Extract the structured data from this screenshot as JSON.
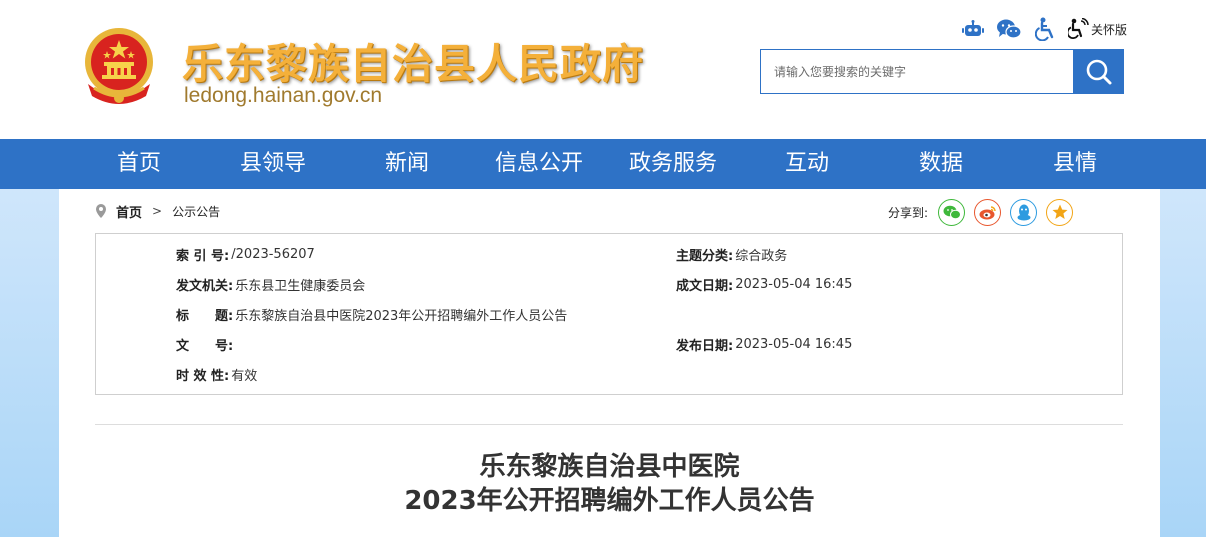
{
  "header": {
    "site_title": "乐东黎族自治县人民政府",
    "site_domain": "ledong.hainan.gov.cn",
    "tools": {
      "robot": "robot-icon",
      "wechat": "wechat-icon",
      "accessibility": "accessibility-icon",
      "care_label": "关怀版"
    },
    "search": {
      "placeholder": "请输入您要搜索的关键字"
    }
  },
  "nav": {
    "items": [
      "首页",
      "县领导",
      "新闻",
      "信息公开",
      "政务服务",
      "互动",
      "数据",
      "县情"
    ]
  },
  "breadcrumb": {
    "home": "首页",
    "separator": ">",
    "current": "公示公告"
  },
  "share": {
    "label": "分享到:",
    "targets": [
      "wechat",
      "weibo",
      "qq",
      "qzone"
    ]
  },
  "meta": {
    "index_label": "索 引 号:",
    "index_value": "/2023-56207",
    "category_label": "主题分类:",
    "category_value": "综合政务",
    "issuer_label": "发文机关:",
    "issuer_value": "乐东县卫生健康委员会",
    "created_label": "成文日期:",
    "created_value": "2023-05-04 16:45",
    "title_label": "标　　题:",
    "title_value": "乐东黎族自治县中医院2023年公开招聘编外工作人员公告",
    "docno_label": "文　　号:",
    "docno_value": "",
    "published_label": "发布日期:",
    "published_value": "2023-05-04 16:45",
    "validity_label": "时 效 性:",
    "validity_value": "有效"
  },
  "article": {
    "title_line1": "乐东黎族自治县中医院",
    "title_line2": "2023年公开招聘编外工作人员公告"
  },
  "colors": {
    "primary_blue": "#2e72c6",
    "title_gold": "#f4b03a",
    "domain_brown": "#a07a2e",
    "wechat_green": "#3fb83b",
    "weibo_red": "#e8562d",
    "qq_blue": "#2d9be0",
    "qzone_orange": "#f2a516"
  }
}
